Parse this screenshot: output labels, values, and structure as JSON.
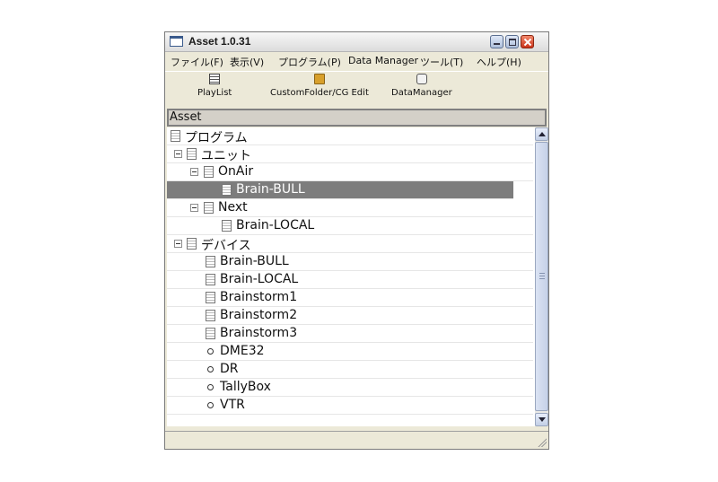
{
  "window": {
    "title": "Asset 1.0.31"
  },
  "menu": [
    "ファイル(F)",
    "表示(V)",
    "プログラム(P)",
    "Data Manager",
    "ツール(T)",
    "ヘルプ(H)"
  ],
  "toolbar": {
    "playlist": "PlayList",
    "customfolder": "CustomFolder/CG Edit",
    "datamanager": "DataManager"
  },
  "panel": {
    "header": "Asset"
  },
  "tree": {
    "program": "プログラム",
    "unit": "ユニット",
    "onair": "OnAir",
    "brain_bull_1": "Brain-BULL",
    "next": "Next",
    "brain_local_1": "Brain-LOCAL",
    "device": "デバイス",
    "brain_bull_2": "Brain-BULL",
    "brain_local_2": "Brain-LOCAL",
    "brainstorm1": "Brainstorm1",
    "brainstorm2": "Brainstorm2",
    "brainstorm3": "Brainstorm3",
    "dme32": "DME32",
    "dr": "DR",
    "tallybox": "TallyBox",
    "vtr": "VTR"
  },
  "icons": {
    "expander": "collapse-icon",
    "document": "document-icon",
    "device": "circle-icon",
    "selection_color": "#7d7d7d"
  }
}
